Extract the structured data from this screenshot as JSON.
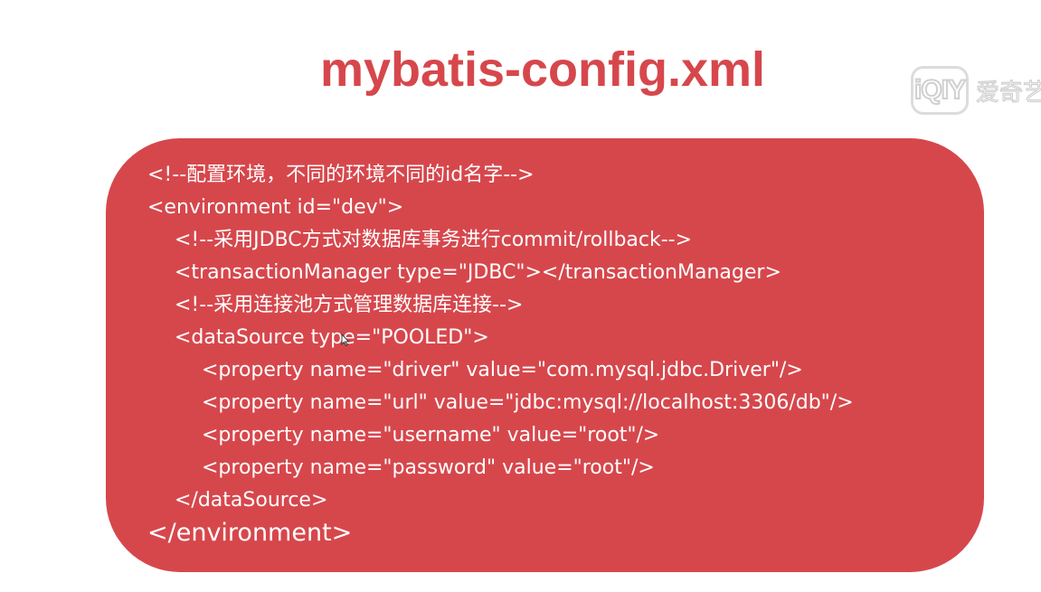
{
  "colors": {
    "accent": "#d6474c",
    "panel_text": "#ffffff",
    "watermark": "#d0d0d0"
  },
  "slide": {
    "title": "mybatis-config.xml"
  },
  "watermark": {
    "logo_text": "iQIY",
    "brand_text": "爱奇艺",
    "icon": "iqiyi-logo-icon"
  },
  "code": {
    "lines": [
      "<!--配置环境，不同的环境不同的id名字-->",
      "<environment id=\"dev\">",
      "<!--采用JDBC方式对数据库事务进行commit/rollback-->",
      "<transactionManager type=\"JDBC\"></transactionManager>",
      "<!--采用连接池方式管理数据库连接-->",
      "<dataSource type=\"POOLED\">",
      "<property name=\"driver\" value=\"com.mysql.jdbc.Driver\"/>",
      "<property name=\"url\" value=\"jdbc:mysql://localhost:3306/db\"/>",
      "<property name=\"username\" value=\"root\"/>",
      "<property name=\"password\" value=\"root\"/>",
      "</dataSource>",
      "</environment>"
    ]
  },
  "cursor": {
    "icon": "mouse-pointer-icon"
  }
}
